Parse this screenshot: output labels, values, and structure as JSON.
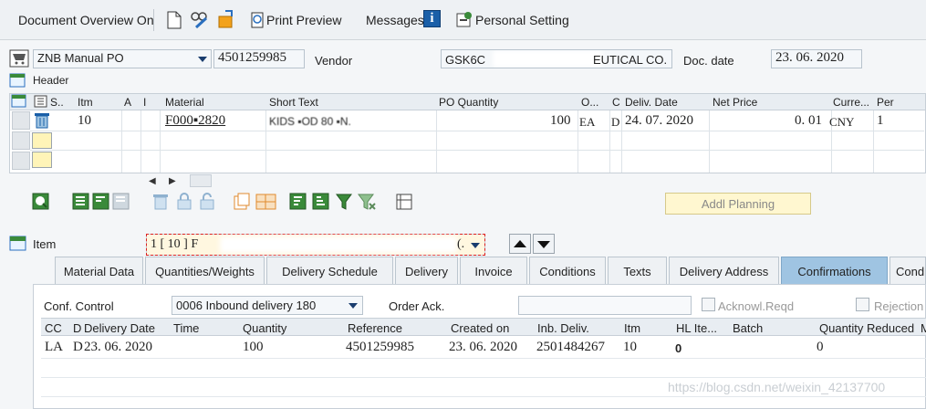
{
  "toolbar": {
    "doc_overview": "Document Overview On",
    "print_preview": "Print Preview",
    "messages": "Messages",
    "personal_setting": "Personal Setting"
  },
  "header": {
    "doc_type": "ZNB Manual PO",
    "po_number": "4501259985",
    "vendor_label": "Vendor",
    "vendor_value": "GSK6C",
    "vendor_value_suffix": "EUTICAL CO.",
    "doc_date_label": "Doc. date",
    "doc_date": "23. 06. 2020",
    "header_label": "Header"
  },
  "items_table": {
    "columns": [
      "S..",
      "Itm",
      "A",
      "I",
      "Material",
      "Short Text",
      "PO Quantity",
      "O...",
      "C",
      "Deliv. Date",
      "Net Price",
      "Curre...",
      "Per"
    ],
    "rows": [
      {
        "itm": "10",
        "material": "F000▪2820",
        "short_text": "KIDS ▪OD 80 ▪N.",
        "po_quantity": "100",
        "unit": "EA",
        "c": "D",
        "deliv_date": "24. 07. 2020",
        "net_price": "0. 01",
        "currency": "CNY",
        "per": "1"
      }
    ],
    "addl_planning": "Addl Planning"
  },
  "item_section": {
    "label": "Item",
    "selector_value": "1 [ 10 ] F",
    "selector_suffix": "(."
  },
  "tabs": [
    {
      "label": "Material Data",
      "active": false
    },
    {
      "label": "Quantities/Weights",
      "active": false
    },
    {
      "label": "Delivery Schedule",
      "active": false
    },
    {
      "label": "Delivery",
      "active": false
    },
    {
      "label": "Invoice",
      "active": false
    },
    {
      "label": "Conditions",
      "active": false
    },
    {
      "label": "Texts",
      "active": false
    },
    {
      "label": "Delivery Address",
      "active": false
    },
    {
      "label": "Confirmations",
      "active": true
    },
    {
      "label": "Condi",
      "active": false
    }
  ],
  "confirmations": {
    "conf_control_label": "Conf. Control",
    "conf_control_value": "0006 Inbound delivery 180",
    "order_ack_label": "Order Ack.",
    "order_ack_value": "",
    "acknowl_reqd": "Acknowl.Reqd",
    "rejection": "Rejection",
    "columns": [
      "CC",
      "D",
      "Delivery Date",
      "Time",
      "Quantity",
      "Reference",
      "Created on",
      "Inb. Deliv.",
      "Itm",
      "HL Ite...",
      "Batch",
      "Quantity Reduced",
      "M"
    ],
    "rows": [
      {
        "cc": "LA",
        "d": "D",
        "delivery_date": "23. 06. 2020",
        "time": "",
        "quantity": "100",
        "reference": "4501259985",
        "created_on": "23. 06. 2020",
        "inb_deliv": "2501484267",
        "itm": "10",
        "hl_item": "0",
        "batch": "",
        "qty_reduced": "0"
      }
    ]
  },
  "watermark": "https://blog.csdn.net/weixin_42137700",
  "colors": {
    "accent": "#1a5fa8",
    "tab_active": "#9fc4e2",
    "yellow": "#fff4b8",
    "green_icon": "#3a8a3a"
  }
}
